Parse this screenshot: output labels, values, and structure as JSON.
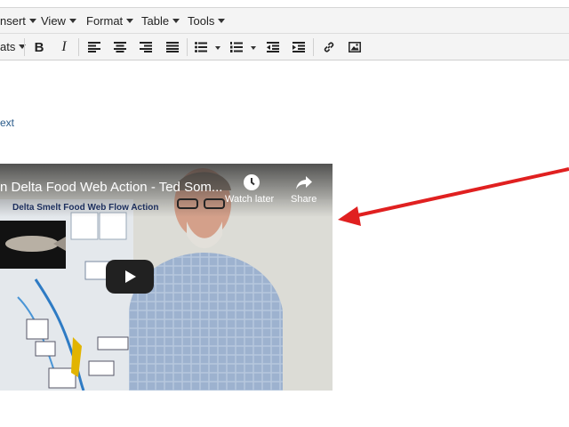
{
  "menubar": {
    "items": [
      "nsert",
      "View",
      "Format",
      "Table",
      "Tools"
    ]
  },
  "toolbar": {
    "formats_label": "ats"
  },
  "content": {
    "link_text": "ext"
  },
  "video": {
    "title": "n Delta Food Web Action - Ted Som...",
    "watch_later_label": "Watch later",
    "share_label": "Share",
    "poster_title": "Delta Smelt Food Web Flow Action"
  },
  "colors": {
    "arrow": "#e02020",
    "menubar_bg": "#f4f4f4"
  }
}
